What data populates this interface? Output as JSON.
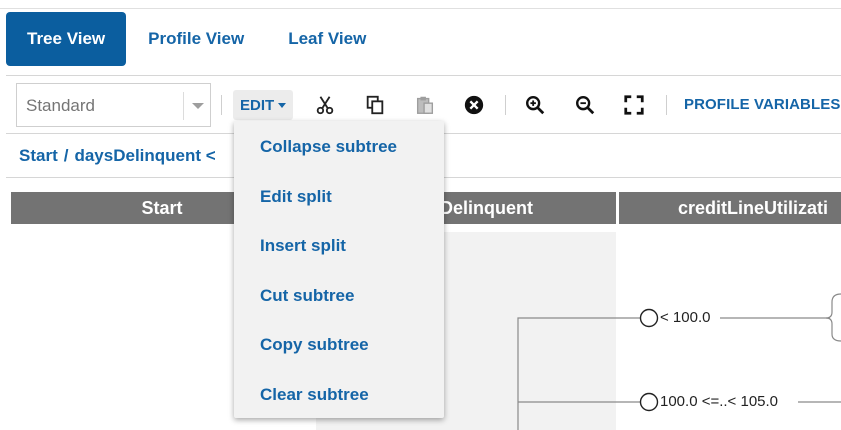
{
  "tabs": [
    {
      "label": "Tree View",
      "active": true
    },
    {
      "label": "Profile View",
      "active": false
    },
    {
      "label": "Leaf View",
      "active": false
    }
  ],
  "toolbar": {
    "select_value": "Standard",
    "edit_label": "EDIT",
    "profile_variables_label": "PROFILE VARIABLES",
    "icons": [
      "scissors-icon",
      "copy-icon",
      "paste-icon",
      "clear-circle-icon",
      "zoom-in-icon",
      "zoom-out-icon",
      "fullscreen-icon"
    ]
  },
  "breadcrumb": {
    "items": [
      "Start",
      "daysDelinquent < "
    ],
    "separator": "/"
  },
  "columns": [
    {
      "label": "Start"
    },
    {
      "label": "Delinquent"
    },
    {
      "label": "creditLineUtilizati"
    }
  ],
  "tree": {
    "nodes": [
      {
        "label": "< 100.0"
      },
      {
        "label": "100.0 <=..< 105.0"
      }
    ]
  },
  "menu": {
    "items": [
      {
        "label": "Collapse subtree"
      },
      {
        "label": "Edit split"
      },
      {
        "label": "Insert split"
      },
      {
        "label": "Cut subtree"
      },
      {
        "label": "Copy subtree"
      },
      {
        "label": "Clear subtree"
      }
    ]
  },
  "colors": {
    "accent": "#0b5e9f",
    "link": "#1565a7",
    "header_bg": "#737373",
    "menu_bg": "#f2f2f2"
  }
}
